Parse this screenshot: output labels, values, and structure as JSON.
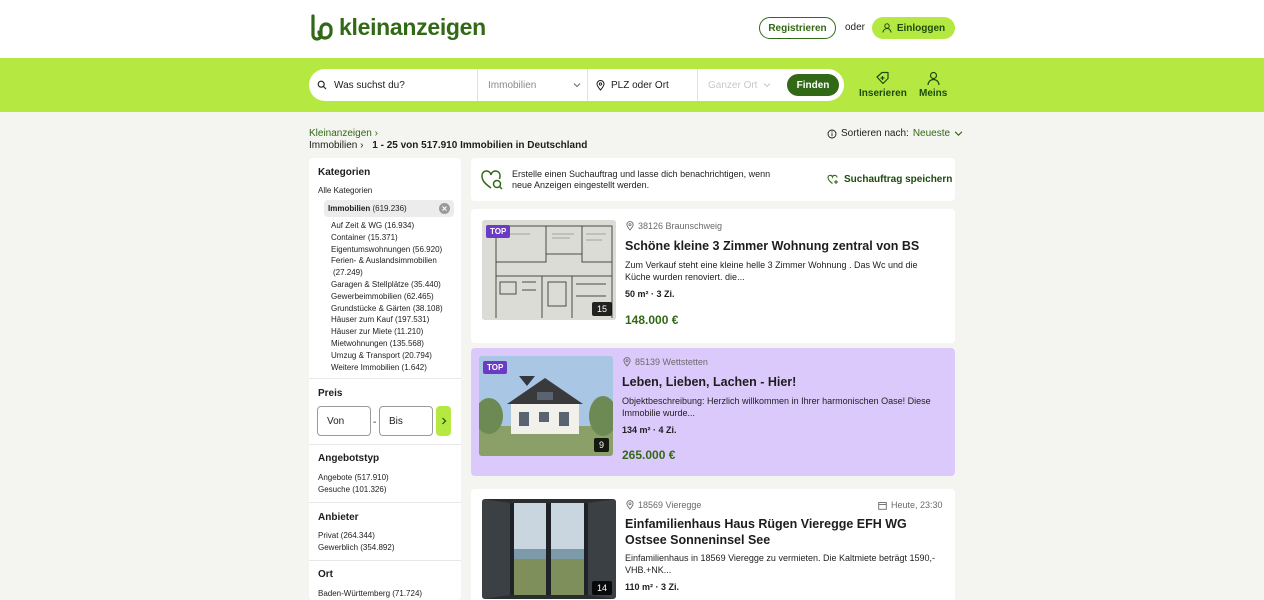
{
  "header": {
    "brand": "kleinanzeigen",
    "register_label": "Registrieren",
    "or_label": "oder",
    "login_label": "Einloggen"
  },
  "search": {
    "query_placeholder": "Was suchst du?",
    "category_value": "Immobilien",
    "location_placeholder": "PLZ oder Ort",
    "radius_value": "Ganzer Ort",
    "find_label": "Finden"
  },
  "nav": {
    "insert_label": "Inserieren",
    "mine_label": "Meins"
  },
  "breadcrumb": {
    "root": "Kleinanzeigen",
    "category": "Immobilien",
    "result_summary": "1 - 25 von 517.910 Immobilien in Deutschland"
  },
  "sort": {
    "label": "Sortieren nach:",
    "value": "Neueste"
  },
  "sidebar": {
    "categories_title": "Kategorien",
    "all_categories": "Alle Kategorien",
    "selected_name": "Immobilien",
    "selected_count": "(619.236)",
    "subcategories": [
      "Auf Zeit & WG  (16.934)",
      "Container  (15.371)",
      "Eigentumswohnungen  (56.920)",
      "Ferien- & Auslandsimmobilien",
      "(27.249)",
      "Garagen & Stellplätze  (35.440)",
      "Gewerbeimmobilien  (62.465)",
      "Grundstücke & Gärten  (38.108)",
      "Häuser zum Kauf  (197.531)",
      "Häuser zur Miete  (11.210)",
      "Mietwohnungen  (135.568)",
      "Umzug & Transport  (20.794)",
      "Weitere Immobilien  (1.642)"
    ],
    "price_title": "Preis",
    "price_from": "Von",
    "price_to": "Bis",
    "price_sep": "-",
    "offer_type_title": "Angebotstyp",
    "offer_types": [
      "Angebote  (517.910)",
      "Gesuche  (101.326)"
    ],
    "provider_title": "Anbieter",
    "providers": [
      "Privat  (264.344)",
      "Gewerblich  (354.892)"
    ],
    "location_title": "Ort",
    "locations": [
      "Baden-Württemberg  (71.724)"
    ]
  },
  "alert": {
    "text": "Erstelle einen Suchauftrag und lasse dich benachrichtigen, wenn neue Anzeigen eingestellt werden.",
    "save_label": "Suchauftrag speichern"
  },
  "listings": [
    {
      "location": "38126 Braunschweig",
      "title": "Schöne kleine 3 Zimmer Wohnung zentral von BS",
      "description": "Zum Verkauf steht eine kleine helle 3 Zimmer Wohnung . Das Wc und die Küche wurden renoviert. die...",
      "facts": "50 m² · 3 Zi.",
      "price": "148.000 €",
      "badge": "TOP",
      "photo_count": "15"
    },
    {
      "location": "85139 Wettstetten",
      "title": "Leben, Lieben, Lachen - Hier!",
      "description": "Objektbeschreibung: Herzlich willkommen in Ihrer harmonischen Oase! Diese Immobilie wurde...",
      "facts": "134 m² · 4 Zi.",
      "price": "265.000 €",
      "badge": "TOP",
      "photo_count": "9"
    },
    {
      "location": "18569 Vieregge",
      "date": "Heute, 23:30",
      "title": "Einfamilienhaus Haus Rügen Vieregge EFH WG Ostsee Sonneninsel See",
      "description": "Einfamilienhaus in 18569 Vieregge zu vermieten. Die Kaltmiete beträgt 1590,-VHB.+NK...",
      "facts": "110 m² · 3 Zi.",
      "photo_count": "14"
    }
  ],
  "colors": {
    "brand_green": "#326916",
    "lime": "#b5e941",
    "top_ad_bg": "#dcc9fb",
    "top_badge": "#6b3bc4"
  }
}
